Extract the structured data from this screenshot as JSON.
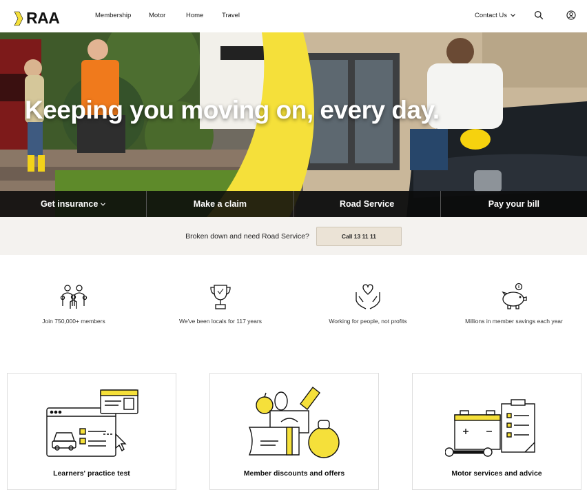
{
  "nav": {
    "logo_text": "RAA",
    "items": [
      "Membership",
      "Motor",
      "Home",
      "Travel"
    ],
    "contact_label": "Contact Us"
  },
  "hero": {
    "title": "Keeping you moving on, every day.",
    "actions": [
      {
        "label": "Get insurance",
        "has_dropdown": true
      },
      {
        "label": "Make a claim",
        "has_dropdown": false
      },
      {
        "label": "Road Service",
        "has_dropdown": false
      },
      {
        "label": "Pay your bill",
        "has_dropdown": false
      }
    ]
  },
  "breakdown": {
    "text": "Broken down and need Road Service?",
    "button_label": "Call 13 11 11"
  },
  "stats": [
    {
      "icon": "family-icon",
      "label": "Join 750,000+ members"
    },
    {
      "icon": "trophy-icon",
      "label": "We've been locals for 117 years"
    },
    {
      "icon": "heart-hands-icon",
      "label": "Working for people, not profits"
    },
    {
      "icon": "piggy-bank-icon",
      "label": "Millions in member savings each year"
    }
  ],
  "cards": [
    {
      "icon": "learners-test-illustration",
      "title": "Learners' practice test"
    },
    {
      "icon": "member-discounts-illustration",
      "title": "Member discounts and offers"
    },
    {
      "icon": "motor-services-illustration",
      "title": "Motor services and advice"
    }
  ],
  "colors": {
    "brand_yellow": "#f5e03a",
    "dark": "#111111",
    "action_bar": "#0a0a0a",
    "breakdown_bg": "#f4f2ef",
    "call_button": "#ebe3d6"
  }
}
